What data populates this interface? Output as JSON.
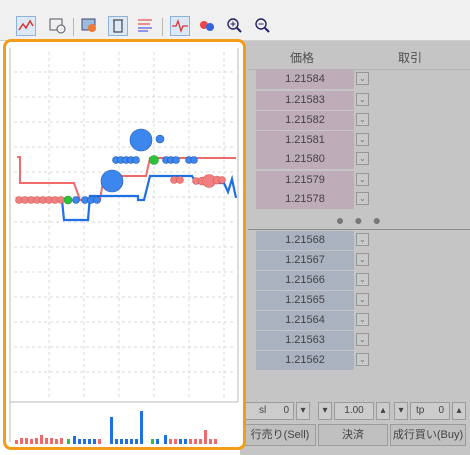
{
  "colors": {
    "highlight": "#f39c1a",
    "ask_row": "#e8cbe0",
    "bid_row": "#c8d4ea",
    "buy_line": "#1f6fe5",
    "sell_line": "#f06a6a",
    "neutral_dot": "#2ec23a"
  },
  "toolbar": {
    "icons": [
      "tick-chart-icon",
      "chart-history-icon",
      "color-palette-icon",
      "trash-icon",
      "depth-list-icon",
      "signal-icon",
      "trade-dots-icon",
      "zoom-in-icon",
      "zoom-out-icon"
    ]
  },
  "depth": {
    "price_header": "価格",
    "trade_header": "取引",
    "ask_prices": [
      "1.21584",
      "1.21583",
      "1.21582",
      "1.21581",
      "1.21580",
      "1.21579",
      "1.21578"
    ],
    "bid_prices": [
      "1.21568",
      "1.21567",
      "1.21566",
      "1.21565",
      "1.21564",
      "1.21563",
      "1.21562"
    ],
    "ellipsis": "● ● ●"
  },
  "controls": {
    "sl_label": "sl",
    "sl_value": "0",
    "volume": "1.00",
    "tp_label": "tp",
    "tp_value": "0",
    "sell_label": "行売り(Sell)",
    "close_label": "決済",
    "buy_label": "成行買い(Buy)"
  }
}
